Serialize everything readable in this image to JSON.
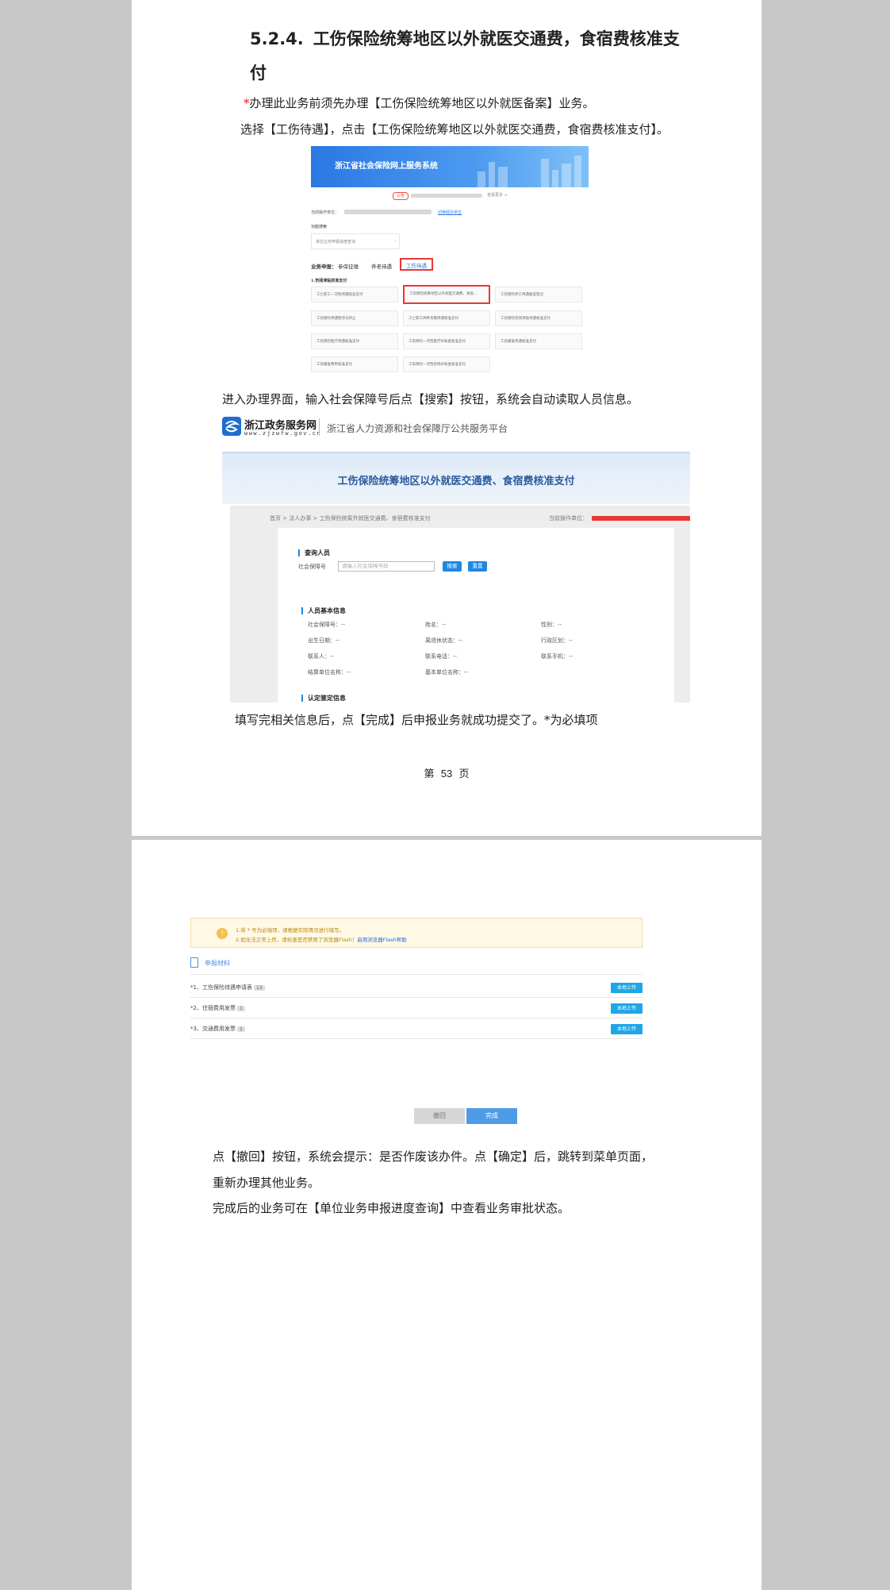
{
  "page1": {
    "heading_number": "5.2.4.",
    "heading_text": "工伤保险统筹地区以外就医交通费，食宿费核准支付",
    "note_mark": "*",
    "note_text": "办理此业务前须先办理【工伤保险统筹地区以外就医备案】业务。",
    "step1": "选择【工伤待遇】，点击【工伤保险统筹地区以外就医交通费，食宿费核准支付】。",
    "step2": "进入办理界面，输入社会保障号后点【搜索】按钮，系统会自动读取人员信息。",
    "step3": "填写完相关信息后，点【完成】后申报业务就成功提交了。*为必填项",
    "page_prefix": "第",
    "page_number": "53",
    "page_suffix": "页"
  },
  "shot1": {
    "banner_title": "浙江省社会保险网上服务系统",
    "notice_badge": "公告",
    "notice_more": "查看更多 >",
    "current_unit_label": "当前操作单位：",
    "switch_unit": "切换经办单位",
    "favorites_label": "功能搜索",
    "select_placeholder": "单位业务申报进度查询",
    "tabs": [
      "业务申报：",
      "参保征缴",
      "养老待遇",
      "工伤待遇"
    ],
    "section_label": "1.伤残津贴核准支付",
    "cells": [
      "工亡职工一次性待遇核准支付",
      "工伤保险统筹地区以外就医交通费，食宿…",
      "工伤保险停工待遇备案登记",
      "工伤保险待遇暂停与终止",
      "工亡职工供养亲属待遇核准支付",
      "工伤保险伤残津贴待遇核准支付",
      "工伤保险医疗待遇核准支付",
      "工伤保险一次性医疗补助金核准支付",
      "工伤康复待遇核准支付",
      "工伤康复费用核准支付",
      "工伤保险一次性伤残补助金核准支付"
    ]
  },
  "shot2": {
    "logo_name": "浙江政务服务网",
    "logo_url": "www.zjzwfw.gov.cn",
    "platform": "浙江省人力资源和社会保障厅公共服务平台",
    "band_title": "工伤保险统筹地区以外就医交通费、食宿费核准支付",
    "breadcrumb": "首页 > 法人办事 > 工伤保险统筹外就医交通费、食宿费核准支付",
    "current_unit": "当前操作单位：",
    "query_title": "查询人员",
    "ssn_label": "社会保障号",
    "ssn_placeholder": "请输入社会保障号码",
    "search_btn": "搜索",
    "reset_btn": "重置",
    "basic_title": "人员基本信息",
    "fields": [
      "社会保障号：--",
      "姓名：--",
      "性别：--",
      "出生日期：--",
      "离退休状态：--",
      "行政区划：--",
      "联系人：--",
      "联系电话：--",
      "联系手机：--",
      "结算单位名称：--",
      "基本单位名称：--"
    ],
    "next_title": "认定鉴定信息"
  },
  "shot3": {
    "warn_line1": "1.带 * 号为必填项，请根据实际情况进行填写。",
    "warn_line2": "2.如无法正常上传，请检查是否禁用了浏览器Flash！",
    "warn_link": "启用浏览器Flash帮助",
    "materials_title": "申报材料",
    "rows": [
      {
        "label": "*1、工伤保险待遇申请表",
        "badge": "13",
        "upload": "本地上传"
      },
      {
        "label": "*2、住宿费用发票",
        "badge": "1",
        "upload": "本地上传"
      },
      {
        "label": "*3、交通费用发票",
        "badge": "1",
        "upload": "本地上传"
      }
    ],
    "back_btn": "撤回",
    "done_btn": "完成"
  },
  "page2": {
    "para1_line1": "点【撤回】按钮，系统会提示：是否作废该办件。点【确定】后，跳转到菜单页面，",
    "para1_line2": "重新办理其他业务。",
    "para2": "完成后的业务可在【单位业务申报进度查询】中查看业务审批状态。"
  }
}
